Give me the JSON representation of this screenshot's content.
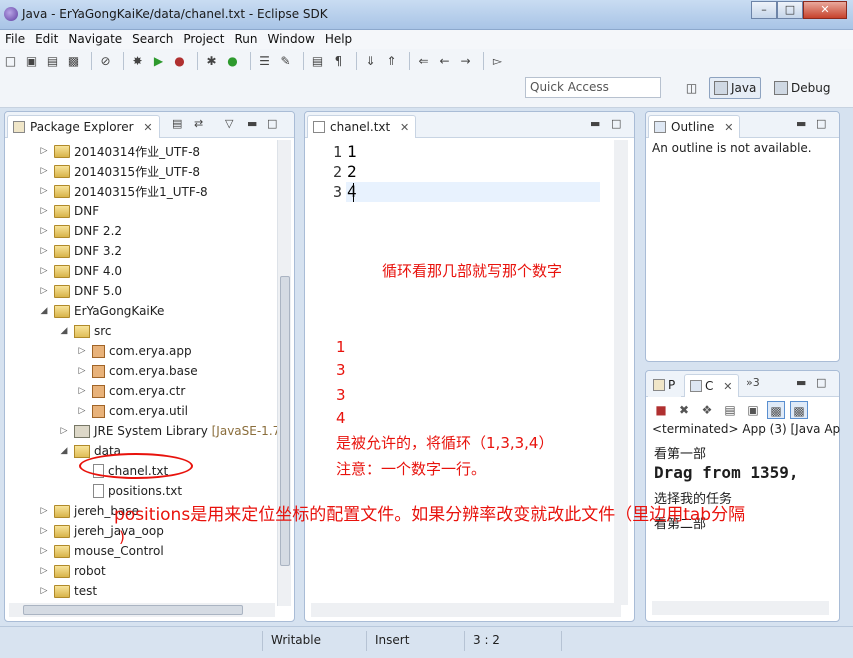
{
  "window": {
    "title": "Java - ErYaGongKaiKe/data/chanel.txt - Eclipse SDK"
  },
  "menu": [
    "File",
    "Edit",
    "Navigate",
    "Search",
    "Project",
    "Run",
    "Window",
    "Help"
  ],
  "toolbar": {
    "quick_access_placeholder": "Quick Access"
  },
  "perspectives": {
    "java": "Java",
    "debug": "Debug"
  },
  "package_explorer": {
    "title": "Package Explorer",
    "items": [
      {
        "label": "20140314作业_UTF-8"
      },
      {
        "label": "20140315作业_UTF-8"
      },
      {
        "label": "20140315作业1_UTF-8"
      },
      {
        "label": "DNF"
      },
      {
        "label": "DNF 2.2"
      },
      {
        "label": "DNF 3.2"
      },
      {
        "label": "DNF 4.0"
      },
      {
        "label": "DNF 5.0"
      },
      {
        "label": "ErYaGongKaiKe"
      },
      {
        "label": "src"
      },
      {
        "label": "com.erya.app"
      },
      {
        "label": "com.erya.base"
      },
      {
        "label": "com.erya.ctr"
      },
      {
        "label": "com.erya.util"
      },
      {
        "label": "JRE System Library",
        "suffix": "[JavaSE-1.7"
      },
      {
        "label": "data"
      },
      {
        "label": "chanel.txt"
      },
      {
        "label": "positions.txt"
      },
      {
        "label": "jereh_base"
      },
      {
        "label": "jereh_java_oop"
      },
      {
        "label": "mouse_Control"
      },
      {
        "label": "robot"
      },
      {
        "label": "test"
      }
    ]
  },
  "editor": {
    "tab": "chanel.txt",
    "lines": [
      {
        "num": "1",
        "text": "1"
      },
      {
        "num": "2",
        "text": "2"
      },
      {
        "num": "3",
        "text": "4"
      }
    ]
  },
  "outline": {
    "tab": "Outline",
    "message": "An outline is not available."
  },
  "console": {
    "tabs": {
      "p": "P",
      "c": "C",
      "more": "»3"
    },
    "status": "<terminated> App (3) [Java Ap",
    "lines": [
      "看第一部",
      "Drag from 1359,",
      "选择我的任务",
      "看第二部"
    ]
  },
  "statusbar": {
    "writable": "Writable",
    "insert": "Insert",
    "position": "3 : 2"
  },
  "annotations": {
    "loop_note": "循环看那几部就写那个数字",
    "n1": "1",
    "n2": "3",
    "n3": "3",
    "n4": "4",
    "allowed": "是被允许的，将循环（1,3,3,4）",
    "note": "注意：一个数字一行。",
    "positions": "positions是用来定位坐标的配置文件。如果分辨率改变就改此文件（里边用tab分隔",
    "paren": ")"
  },
  "colors": {
    "annotation": "#e8120c",
    "accent": "#5a8fd0"
  }
}
